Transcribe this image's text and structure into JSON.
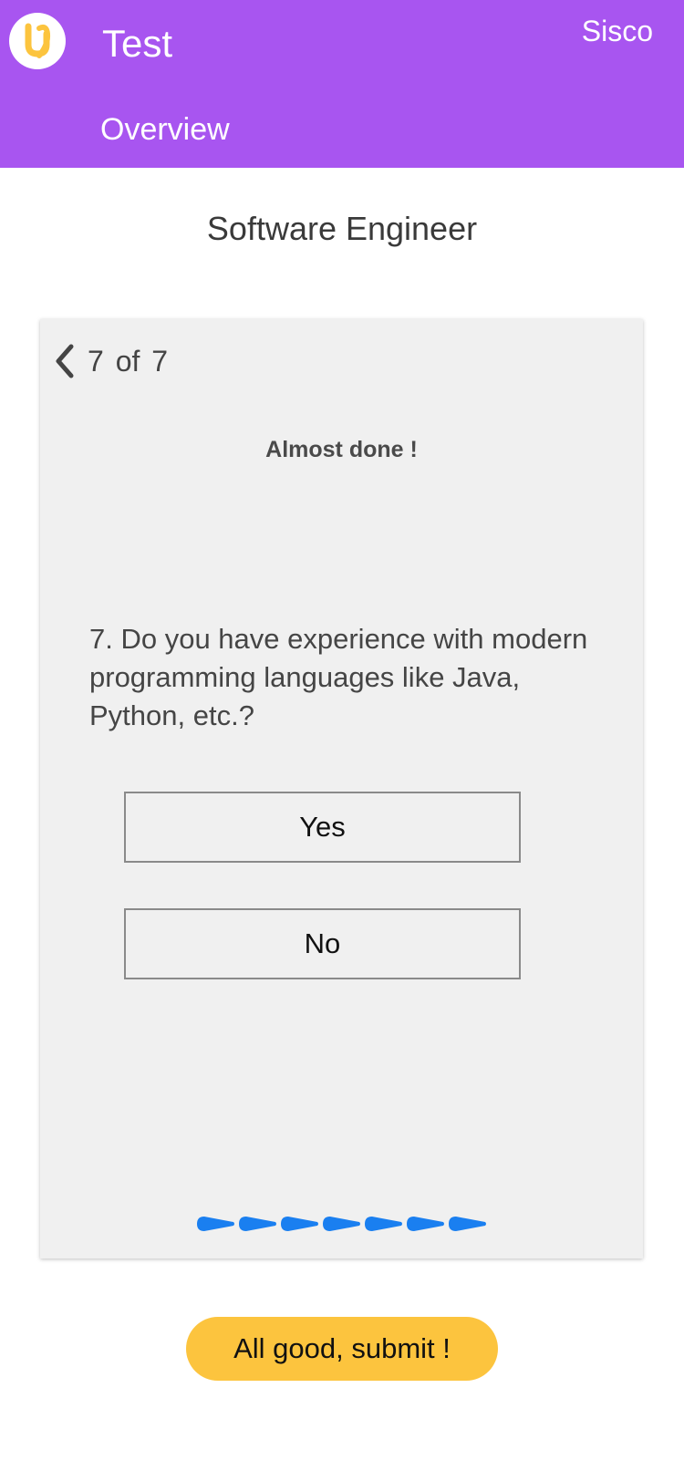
{
  "header": {
    "app_title": "Test",
    "user_name": "Sisco",
    "nav_overview": "Overview",
    "background_color": "#a855f0",
    "logo_color": "#fcc43e"
  },
  "page": {
    "title": "Software Engineer"
  },
  "quiz": {
    "current": "7",
    "of_label": "of",
    "total": "7",
    "subtitle": "Almost done !",
    "question": "7. Do you have experience with modern programming languages like Java, Python, etc.?",
    "options": [
      {
        "label": "Yes"
      },
      {
        "label": "No"
      }
    ],
    "progress": {
      "completed_steps": 7,
      "total_steps": 7,
      "color": "#1a7ff0"
    }
  },
  "submit": {
    "label": "All good, submit !",
    "color": "#fcc43e"
  }
}
